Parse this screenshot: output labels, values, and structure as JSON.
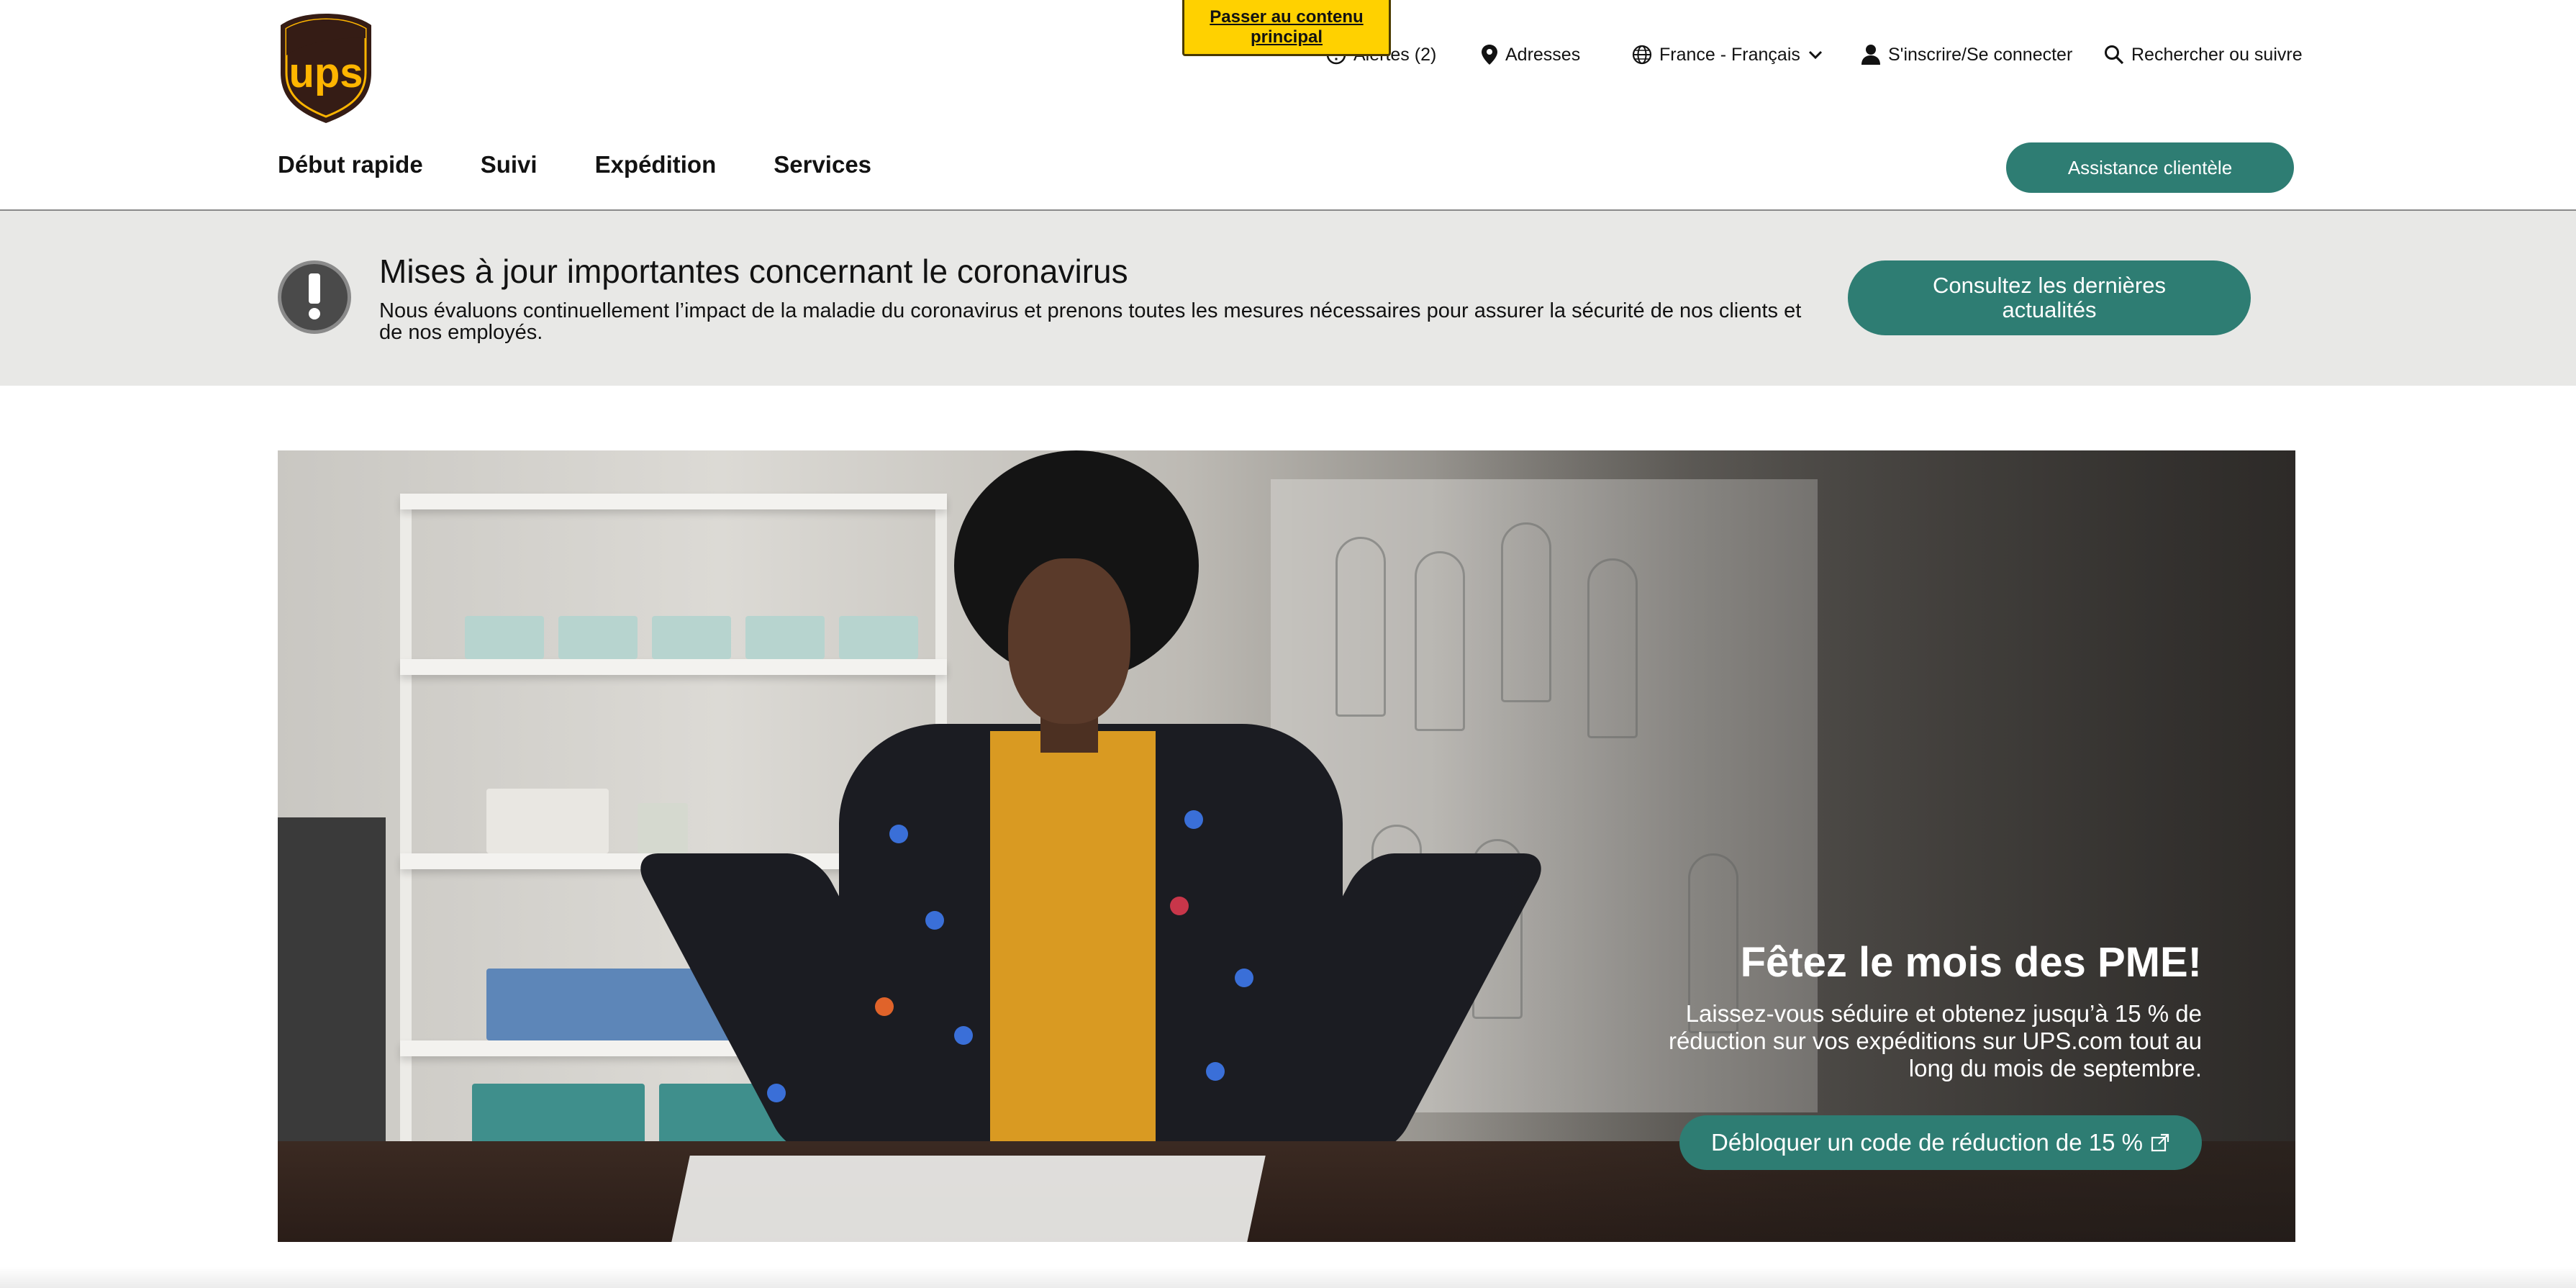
{
  "skip_link": {
    "label": "Passer au contenu principal"
  },
  "logo": {
    "text": "ups",
    "registered": "®"
  },
  "utility_nav": {
    "alerts": "Alertes (2)",
    "locations": "Adresses",
    "language": "France - Français",
    "login": "S'inscrire/Se connecter",
    "search": "Rechercher ou suivre"
  },
  "main_nav": {
    "items": [
      "Début rapide",
      "Suivi",
      "Expédition",
      "Services"
    ]
  },
  "support_button": {
    "label": "Assistance clientèle"
  },
  "alert_banner": {
    "title": "Mises à jour importantes concernant le coronavirus",
    "text": "Nous évaluons continuellement l’impact de la maladie du coronavirus et prenons toutes les mesures nécessaires pour assurer la sécurité de nos clients et de nos employés.",
    "button": "Consultez les dernières actualités"
  },
  "hero": {
    "title": "Fêtez le mois des PME!",
    "text": "Laissez-vous séduire et obtenez jusqu’à 15 % de réduction sur vos expéditions sur UPS.com tout au long du mois de septembre.",
    "button": "Débloquer un code de réduction de 15 %"
  },
  "colors": {
    "brand_brown": "#351c15",
    "brand_gold": "#ffb500",
    "accent_teal": "#2e7d73",
    "skip_yellow": "#ffd100",
    "banner_gray": "#e8e8e6"
  },
  "icons": {
    "alerts": "alert-circle-icon",
    "locations": "location-pin-icon",
    "language": "globe-icon",
    "language_toggle": "chevron-down-icon",
    "login": "user-icon",
    "search": "search-icon",
    "alert_banner": "exclamation-icon",
    "hero_button": "external-link-icon"
  }
}
